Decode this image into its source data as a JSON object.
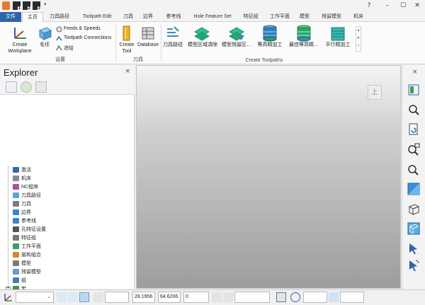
{
  "titlebar": {
    "quick_access": [
      "1",
      "2",
      "3"
    ],
    "help_symbol": "?",
    "minimize_symbol": "–",
    "maximize_symbol": "☐",
    "close_symbol": "✕"
  },
  "tabs": [
    {
      "label": "文件",
      "state": "file"
    },
    {
      "label": "主页",
      "state": "active"
    },
    {
      "label": "刀具路径"
    },
    {
      "label": "Toolpath Edit"
    },
    {
      "label": "刀具"
    },
    {
      "label": "边界"
    },
    {
      "label": "参考线"
    },
    {
      "label": "Hole Feature Set"
    },
    {
      "label": "特征组"
    },
    {
      "label": "工作平面"
    },
    {
      "label": "模型"
    },
    {
      "label": "残留模型"
    },
    {
      "label": "机床"
    }
  ],
  "ribbon": {
    "setup": {
      "create_workplane_line1": "Create",
      "create_workplane_line2": "Workplane",
      "block": "毛坯",
      "feeds_speeds": "Feeds & Speeds",
      "toolpath_connections": "Toolpath Connections",
      "leads_links": "进给",
      "group_label": "设置"
    },
    "tool": {
      "create_tool_line1": "Create",
      "create_tool_line2": "Tool",
      "database": "Database",
      "group_label": "刀具"
    },
    "create_toolpaths": {
      "items": [
        "刀具路径",
        "模型区域清除",
        "模型残留区…",
        "等高精加工",
        "最佳等高精…",
        "平行精加工"
      ],
      "group_label": "Create Toolpaths"
    }
  },
  "explorer": {
    "title": "Explorer",
    "close_symbol": "×",
    "tree": [
      {
        "label": "激活",
        "icon": "activate-icon",
        "color": "#3466b5"
      },
      {
        "label": "机床",
        "icon": "machine-icon",
        "color": "#8a8a8a"
      },
      {
        "label": "NC程序",
        "icon": "nc-program-icon",
        "color": "#b04f9b"
      },
      {
        "label": "刀具路径",
        "icon": "toolpath-icon",
        "color": "#58a6d8"
      },
      {
        "label": "刀具",
        "icon": "tool-icon",
        "color": "#7d7d7d"
      },
      {
        "label": "边界",
        "icon": "boundary-icon",
        "color": "#3a86c8"
      },
      {
        "label": "参考线",
        "icon": "pattern-icon",
        "color": "#3a86c8"
      },
      {
        "label": "孔特征设置",
        "icon": "hole-feature-icon",
        "color": "#555555"
      },
      {
        "label": "特征组",
        "icon": "feature-group-icon",
        "color": "#777777"
      },
      {
        "label": "工作平面",
        "icon": "workplane-icon",
        "color": "#3aa05a"
      },
      {
        "label": "层和组合",
        "icon": "layers-icon",
        "color": "#d38b2a"
      },
      {
        "label": "模型",
        "icon": "model-icon",
        "color": "#7a7a7a"
      },
      {
        "label": "残留模型",
        "icon": "stock-model-icon",
        "color": "#5d9fd0"
      },
      {
        "label": "组",
        "icon": "group-icon",
        "color": "#4d7ab7"
      },
      {
        "label": "宏",
        "icon": "macro-icon",
        "color": "#5c8a3a"
      }
    ]
  },
  "viewport": {
    "viewcube_label": "上"
  },
  "statusbar": {
    "x": "28.1956",
    "y": "64.6206",
    "z": "0"
  }
}
